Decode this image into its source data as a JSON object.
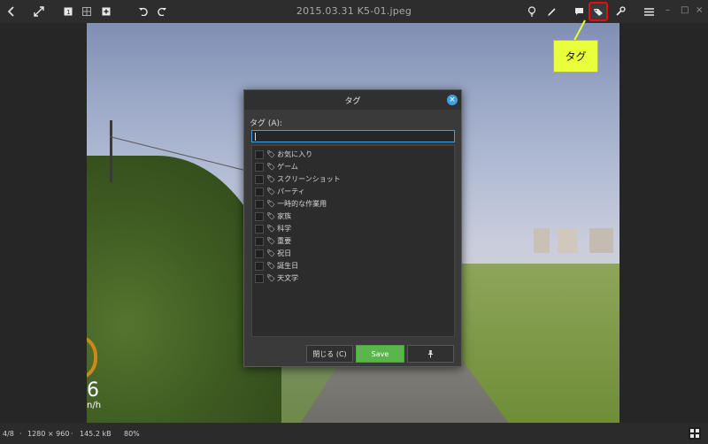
{
  "app": {
    "title": "2015.03.31 K5-01.jpeg"
  },
  "toolbar": {
    "left_icons": [
      "back-icon",
      "fullscreen-icon",
      "view-1-icon",
      "view-grid-icon",
      "view-plus-icon",
      "undo-icon",
      "redo-icon"
    ],
    "right_icons": [
      "lightbulb-icon",
      "pencil-icon",
      "comment-icon",
      "tag-icon",
      "wrench-icon",
      "menu-icon"
    ],
    "window_buttons": [
      "–",
      "□",
      "×"
    ]
  },
  "photo": {
    "hud_number": "6",
    "hud_unit": "n/h"
  },
  "callout": {
    "label": "タグ"
  },
  "dialog": {
    "title": "タグ",
    "field_label": "タグ (A):",
    "input_value": "",
    "tags": [
      {
        "label": "お気に入り",
        "checked": false
      },
      {
        "label": "ゲーム",
        "checked": false
      },
      {
        "label": "スクリーンショット",
        "checked": false
      },
      {
        "label": "パーティ",
        "checked": false
      },
      {
        "label": "一時的な作業用",
        "checked": false
      },
      {
        "label": "家族",
        "checked": false
      },
      {
        "label": "科学",
        "checked": false
      },
      {
        "label": "重要",
        "checked": false
      },
      {
        "label": "祝日",
        "checked": false
      },
      {
        "label": "誕生日",
        "checked": false
      },
      {
        "label": "天文学",
        "checked": false
      }
    ],
    "close_label": "閉じる (C)",
    "save_label": "Save",
    "pin_icon": "pin-icon",
    "accent_color": "#3da0e0",
    "save_color": "#59b64a"
  },
  "status": {
    "index": "4/8",
    "dimensions": "1280 × 960",
    "size": "145.2 kB",
    "zoom": "80%",
    "separator": "·"
  }
}
